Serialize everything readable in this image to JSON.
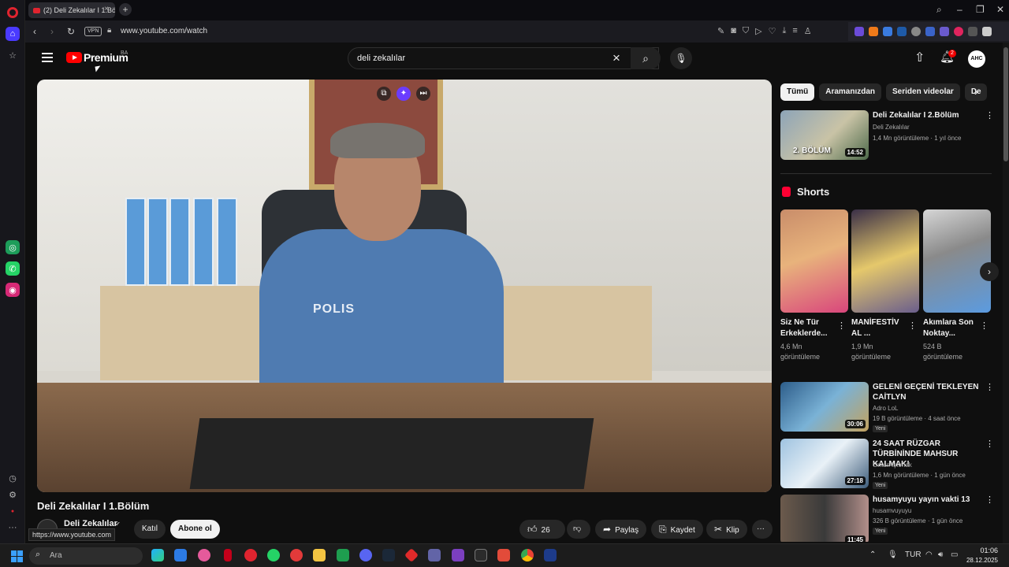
{
  "browser": {
    "tab_title": "(2) Deli Zekalılar I 1.Bölüm",
    "url": "www.youtube.com/watch",
    "vpn_label": "VPN",
    "status_url": "https://www.youtube.com"
  },
  "header": {
    "logo_text": "Premium",
    "region": "BA",
    "search_value": "deli zekalılar",
    "notification_count": "2",
    "avatar_initials": "AHC"
  },
  "video": {
    "title": "Deli Zekalılar I 1.Bölüm",
    "scene_badge": "POLIS",
    "channel": "Deli Zekalılar",
    "join_label": "Katıl",
    "subscribe_label": "Abone ol",
    "likes": "26 B",
    "share_label": "Paylaş",
    "save_label": "Kaydet",
    "clip_label": "Klip"
  },
  "chips": [
    "Tümü",
    "Aramanızdan",
    "Seriden videolar",
    "De"
  ],
  "recommendations_top": {
    "title": "Deli Zekalılar I 2.Bölüm",
    "channel": "Deli Zekalılar",
    "meta": "1,4 Mn görüntüleme · 1 yıl önce",
    "duration": "14:52",
    "thumb_text": "2. BÖLÜM"
  },
  "shorts": {
    "heading": "Shorts",
    "items": [
      {
        "title": "Siz Ne Tür Erkeklerde...",
        "views": "4,6 Mn görüntüleme"
      },
      {
        "title": "MANİFESTİV AL ...",
        "views": "1,9 Mn görüntüleme"
      },
      {
        "title": "Akımlara Son Noktay...",
        "views": "524 B görüntüleme"
      }
    ]
  },
  "recommendations": [
    {
      "title": "GELENİ GEÇENİ TEKLEYEN CAİTLYN",
      "channel": "Adro LoL",
      "meta": "19 B görüntüleme · 4 saat önce",
      "badge": "Yeni",
      "duration": "30:06"
    },
    {
      "title": "24 SAAT RÜZGAR TÜRBİNİNDE MAHSUR KALMAK!",
      "channel": "Orkun Işıtmak",
      "meta": "1,6 Mn görüntüleme · 1 gün önce",
      "badge": "Yeni",
      "duration": "27:18"
    },
    {
      "title": "husamyuyu yayın vakti 13",
      "channel": "husamvuyuyu",
      "meta": "326 B görüntüleme · 1 gün önce",
      "badge": "Yeni",
      "duration": "11:45"
    }
  ],
  "taskbar": {
    "search_placeholder": "Ara",
    "language": "TUR",
    "time": "01:06",
    "date": "28.12.2025"
  },
  "colors": {
    "background": "#0f0f0f",
    "youtube_red": "#ff0000",
    "opera_active": "#4a3aff",
    "text_secondary": "#aaaaaa"
  }
}
